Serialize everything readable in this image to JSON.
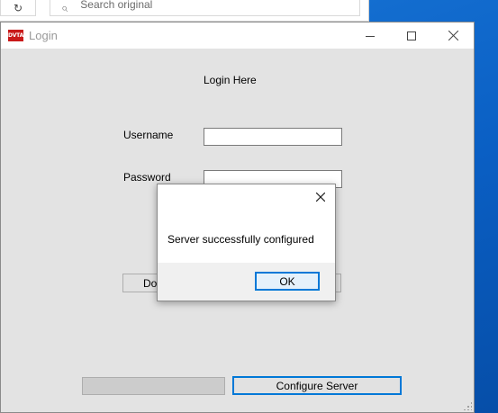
{
  "background": {
    "search_placeholder": "Search original",
    "desktop_color": "#0a64c8"
  },
  "window": {
    "title": "Login",
    "app_logo_text": "DVTA",
    "minimize_icon": "minimize-icon",
    "maximize_icon": "maximize-icon",
    "close_icon": "close-icon"
  },
  "form": {
    "header": "Login Here",
    "username_label": "Username",
    "username_value": "",
    "password_label": "Password",
    "password_value": "",
    "done_button_label": "Done",
    "configure_button_label": "Configure Server"
  },
  "dialog": {
    "message": "Server successfully configured",
    "ok_label": "OK"
  },
  "colors": {
    "accent": "#0078d7",
    "window_bg": "#e3e3e3",
    "logo": "#c91919"
  }
}
